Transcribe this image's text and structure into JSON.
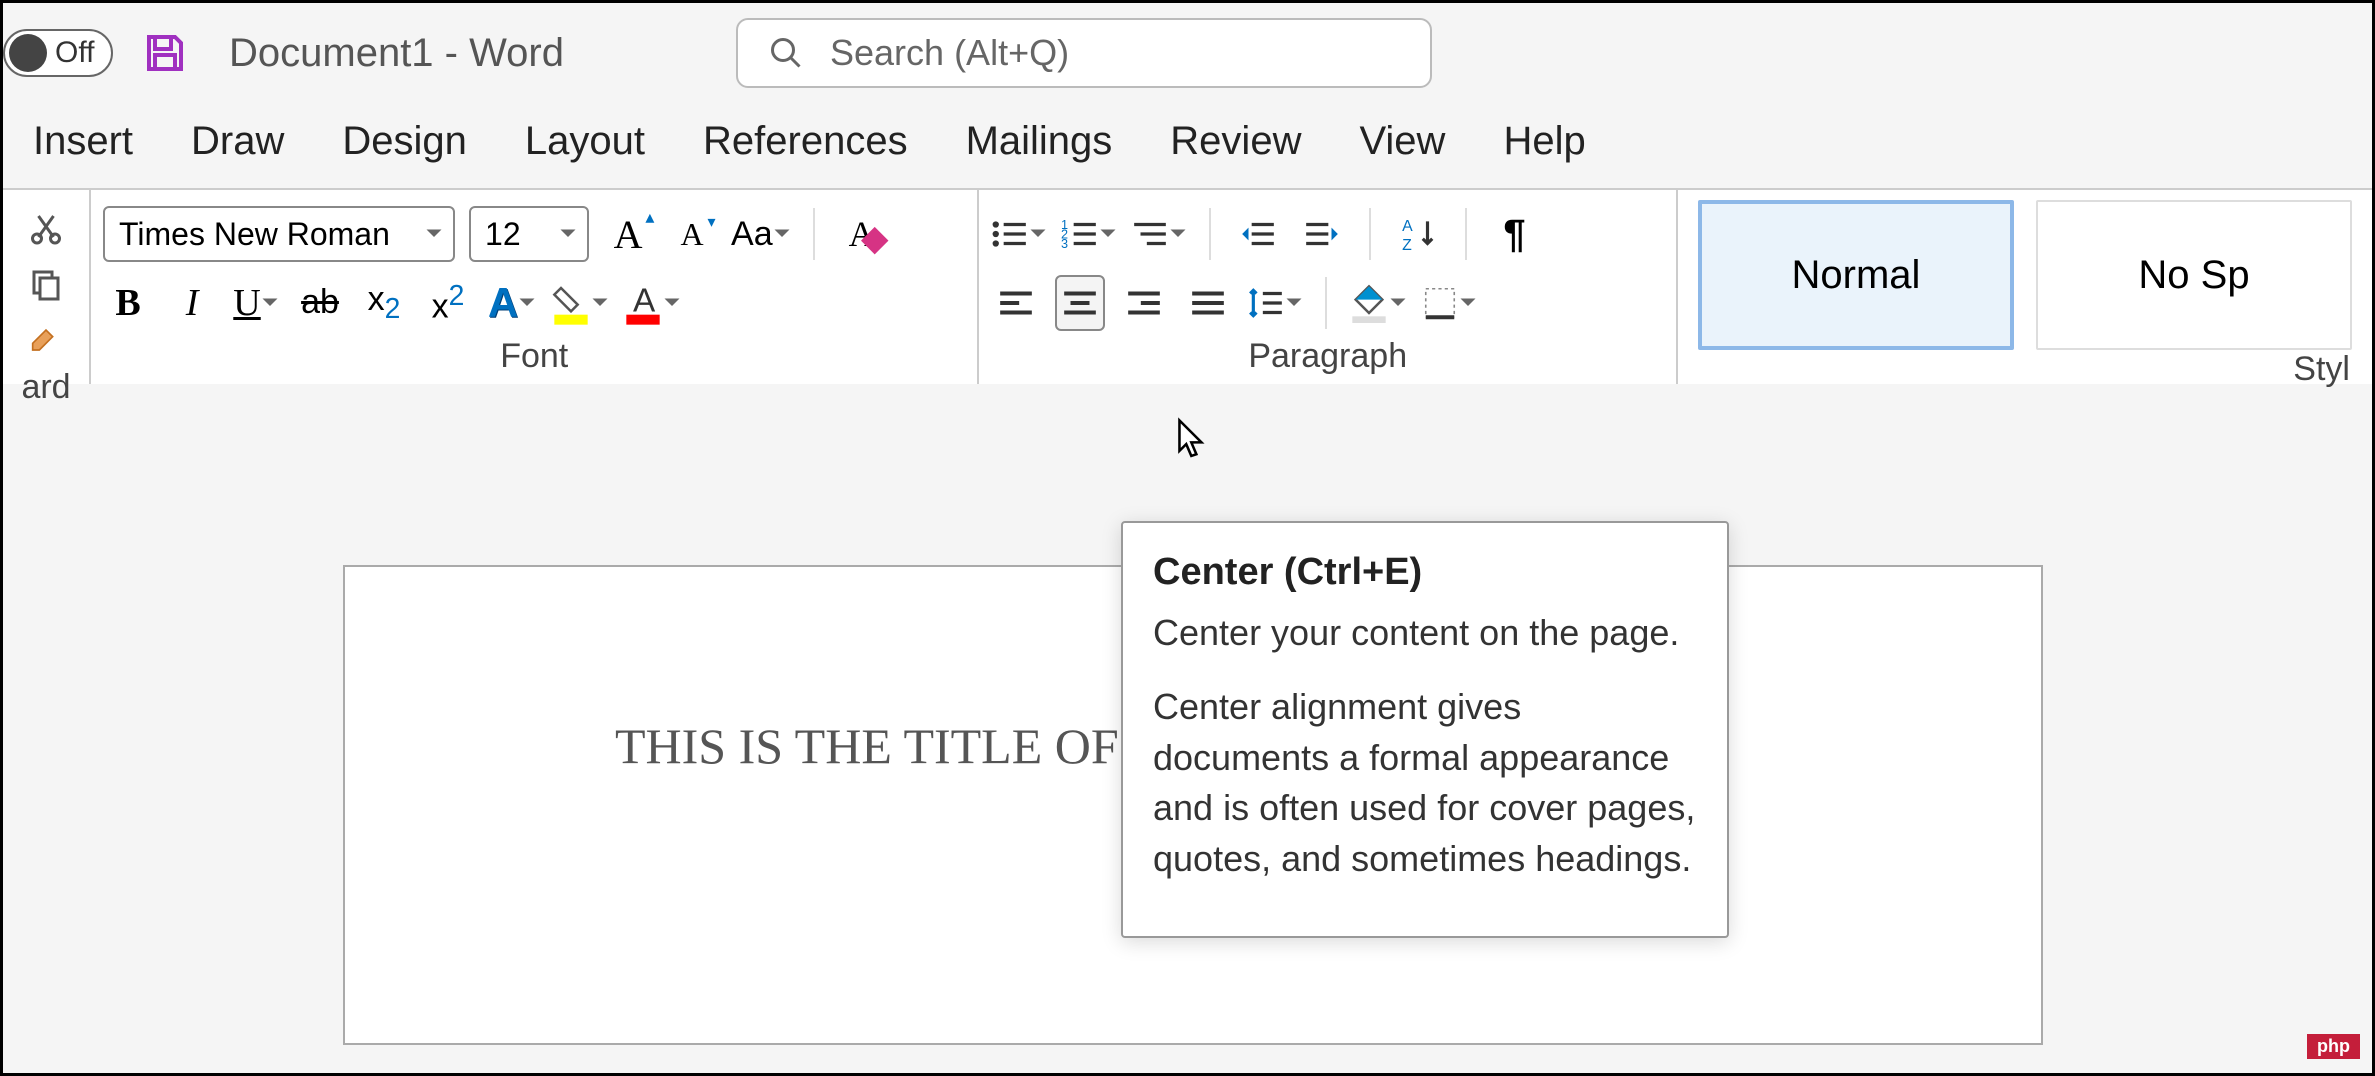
{
  "titlebar": {
    "toggle_label": "Off",
    "document_title": "Document1  -  Word"
  },
  "search": {
    "placeholder": "Search (Alt+Q)"
  },
  "tabs": {
    "items": [
      "Insert",
      "Draw",
      "Design",
      "Layout",
      "References",
      "Mailings",
      "Review",
      "View",
      "Help"
    ]
  },
  "ribbon": {
    "clipboard": {
      "label": "ard"
    },
    "font": {
      "label": "Font",
      "name": "Times New Roman",
      "size": "12"
    },
    "paragraph": {
      "label": "Paragraph"
    },
    "styles": {
      "label": "Styl",
      "normal": "Normal",
      "nospacing": "No Sp"
    }
  },
  "tooltip": {
    "title": "Center (Ctrl+E)",
    "line1": "Center your content on the page.",
    "line2": "Center alignment gives documents a formal appearance and is often used for cover pages, quotes, and sometimes headings."
  },
  "document": {
    "body_text": "THIS IS THE TITLE OF M"
  },
  "badge": "php"
}
